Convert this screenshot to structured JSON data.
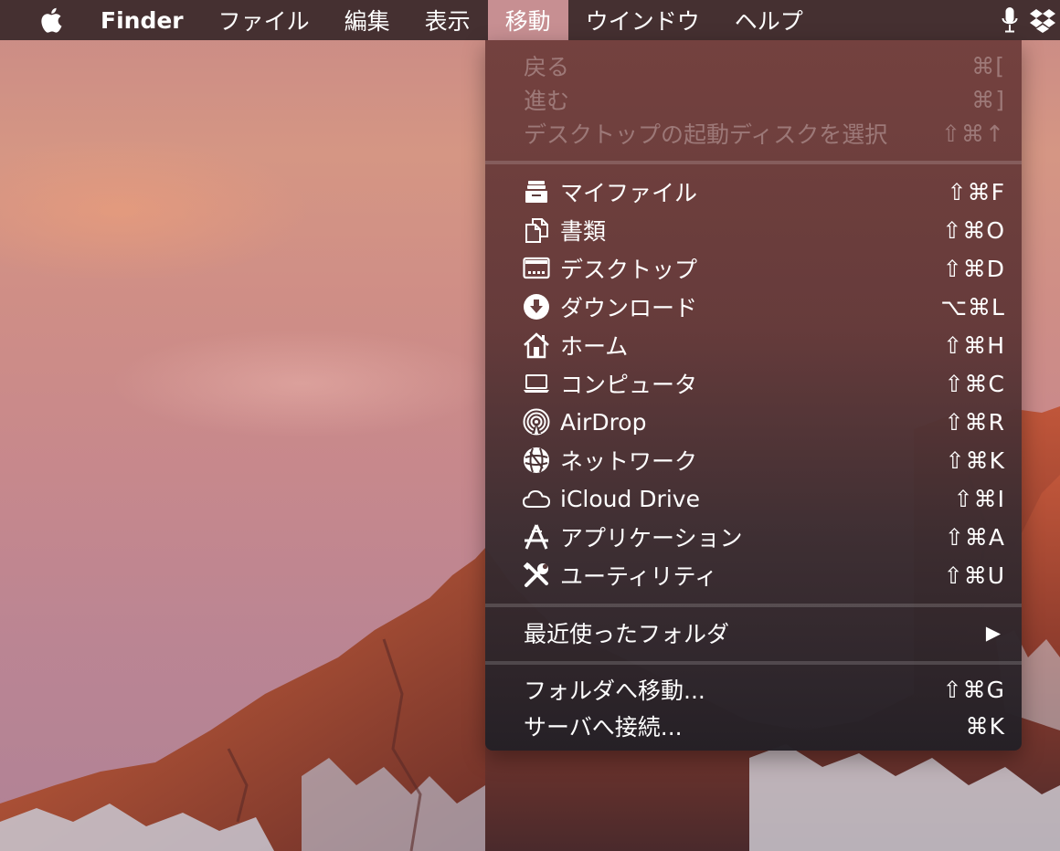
{
  "menubar": {
    "app_name": "Finder",
    "menus": [
      "ファイル",
      "編集",
      "表示",
      "移動",
      "ウインドウ",
      "ヘルプ"
    ],
    "active_menu": "移動"
  },
  "go_menu": {
    "history": [
      {
        "label": "戻る",
        "shortcut": "⌘[",
        "enabled": false
      },
      {
        "label": "進む",
        "shortcut": "⌘]",
        "enabled": false
      },
      {
        "label": "デスクトップの起動ディスクを選択",
        "shortcut": "⇧⌘↑",
        "enabled": false
      }
    ],
    "locations": [
      {
        "label": "マイファイル",
        "shortcut": "⇧⌘F",
        "icon": "all-my-files-icon"
      },
      {
        "label": "書類",
        "shortcut": "⇧⌘O",
        "icon": "documents-icon"
      },
      {
        "label": "デスクトップ",
        "shortcut": "⇧⌘D",
        "icon": "desktop-icon"
      },
      {
        "label": "ダウンロード",
        "shortcut": "⌥⌘L",
        "icon": "downloads-icon"
      },
      {
        "label": "ホーム",
        "shortcut": "⇧⌘H",
        "icon": "home-icon"
      },
      {
        "label": "コンピュータ",
        "shortcut": "⇧⌘C",
        "icon": "computer-icon"
      },
      {
        "label": "AirDrop",
        "shortcut": "⇧⌘R",
        "icon": "airdrop-icon"
      },
      {
        "label": "ネットワーク",
        "shortcut": "⇧⌘K",
        "icon": "network-icon"
      },
      {
        "label": "iCloud Drive",
        "shortcut": "⇧⌘I",
        "icon": "icloud-icon"
      },
      {
        "label": "アプリケーション",
        "shortcut": "⇧⌘A",
        "icon": "applications-icon"
      },
      {
        "label": "ユーティリティ",
        "shortcut": "⇧⌘U",
        "icon": "utilities-icon"
      }
    ],
    "recent": {
      "label": "最近使ったフォルダ",
      "submenu_arrow": "▶"
    },
    "connect": [
      {
        "label": "フォルダへ移動...",
        "shortcut": "⇧⌘G"
      },
      {
        "label": "サーバへ接続...",
        "shortcut": "⌘K"
      }
    ]
  },
  "colors": {
    "menubar_bg": "#3a282a",
    "active_menu_bg": "#c78f92",
    "disabled_text": "#a88e8e"
  }
}
